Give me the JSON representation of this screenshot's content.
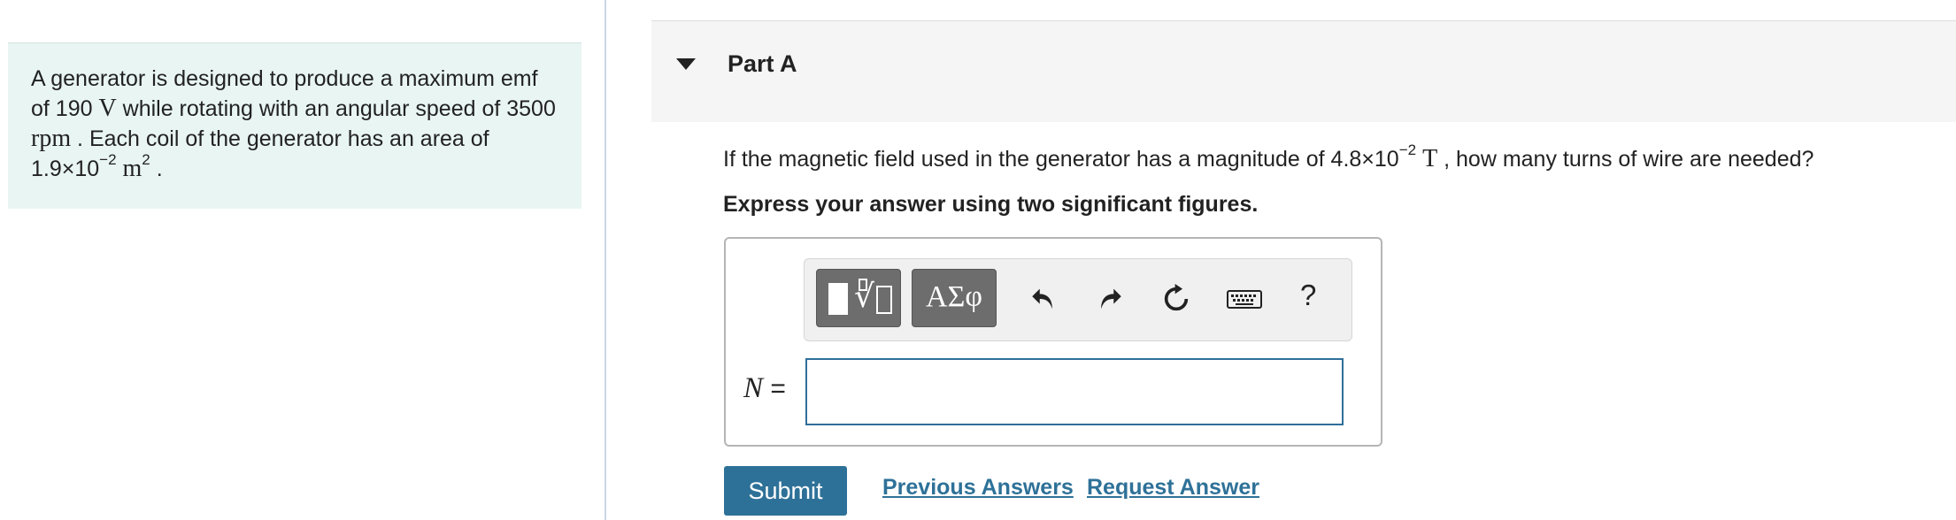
{
  "problem": {
    "text_1": "A generator is designed to produce a maximum emf of 190 ",
    "unit_1": "V",
    "text_2": " while rotating with an angular speed of 3500 ",
    "unit_2": "rpm",
    "text_3": " . Each coil of the generator has an area of 1.9×10",
    "exp_1": "−2",
    "unit_3": "m",
    "exp_2": "2",
    "text_4": " ."
  },
  "part": {
    "title": "Part A",
    "question_1": "If the magnetic field used in the generator has a magnitude of 4.8×10",
    "question_exp": "−2",
    "question_unit": "T",
    "question_2": " , how many turns of wire are needed?",
    "instructions": "Express your answer using two significant figures."
  },
  "toolbar": {
    "symbols_label": "ΑΣφ",
    "help_label": "?",
    "root_glyph": "√"
  },
  "answer": {
    "variable": "N",
    "equals": " =",
    "value": ""
  },
  "actions": {
    "submit_label": "Submit",
    "previous_answers_label": "Previous Answers",
    "request_answer_label": "Request Answer"
  },
  "colors": {
    "problem_bg": "#e8f5f3",
    "accent": "#2e7198",
    "header_bg": "#f5f5f5"
  },
  "icons": [
    "caret-down-icon",
    "templates-icon",
    "undo-icon",
    "redo-icon",
    "reset-icon",
    "keyboard-icon",
    "help-icon"
  ]
}
